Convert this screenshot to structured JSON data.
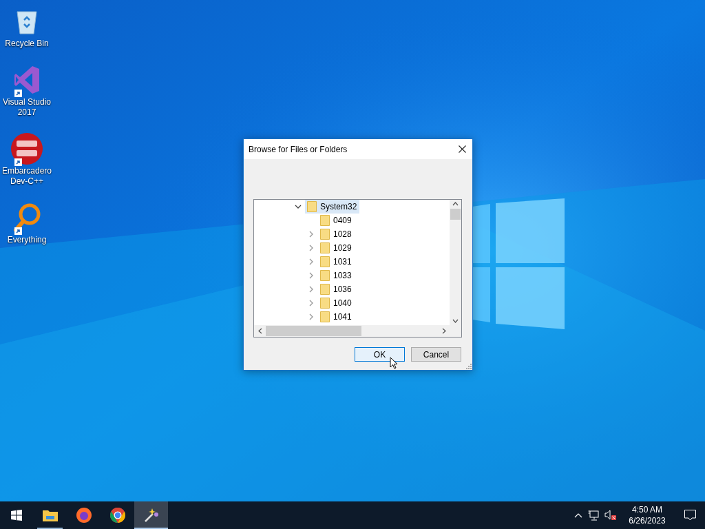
{
  "desktop_icons": [
    {
      "kind": "recycle",
      "label": "Recycle Bin",
      "shortcut": false
    },
    {
      "kind": "vs",
      "label": "Visual Studio 2017",
      "shortcut": true
    },
    {
      "kind": "devcpp",
      "label": "Embarcadero Dev-C++",
      "shortcut": true
    },
    {
      "kind": "search",
      "label": "Everything",
      "shortcut": true
    }
  ],
  "dialog": {
    "title": "Browse for Files or Folders",
    "tree": [
      {
        "label": "System32",
        "expandable": true,
        "expanded": true,
        "selected": true,
        "children": [
          {
            "label": "0409",
            "expandable": false,
            "expanded": false,
            "selected": false
          },
          {
            "label": "1028",
            "expandable": true,
            "expanded": false,
            "selected": false
          },
          {
            "label": "1029",
            "expandable": true,
            "expanded": false,
            "selected": false
          },
          {
            "label": "1031",
            "expandable": true,
            "expanded": false,
            "selected": false
          },
          {
            "label": "1033",
            "expandable": true,
            "expanded": false,
            "selected": false
          },
          {
            "label": "1036",
            "expandable": true,
            "expanded": false,
            "selected": false
          },
          {
            "label": "1040",
            "expandable": true,
            "expanded": false,
            "selected": false
          },
          {
            "label": "1041",
            "expandable": true,
            "expanded": false,
            "selected": false
          }
        ]
      }
    ],
    "buttons": [
      {
        "label": "OK",
        "default": true
      },
      {
        "label": "Cancel",
        "default": false
      }
    ]
  },
  "taskbar": {
    "apps": [
      {
        "kind": "explorer",
        "running": true,
        "active": false
      },
      {
        "kind": "firefox",
        "running": false,
        "active": false
      },
      {
        "kind": "chrome",
        "running": false,
        "active": false
      },
      {
        "kind": "wand",
        "running": true,
        "active": true
      }
    ],
    "time": "4:50 AM",
    "date": "6/26/2023"
  }
}
